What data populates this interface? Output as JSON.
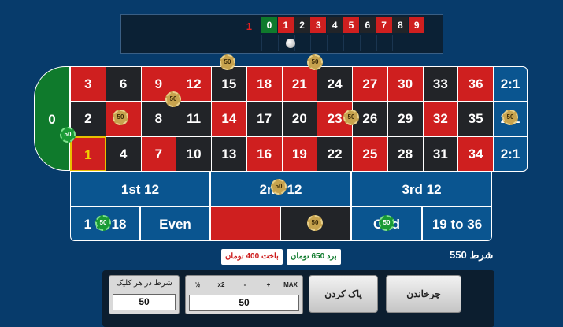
{
  "history": {
    "latest": "1",
    "numbers": [
      {
        "n": "0",
        "color": "green"
      },
      {
        "n": "1",
        "color": "red"
      },
      {
        "n": "2",
        "color": "black"
      },
      {
        "n": "3",
        "color": "red"
      },
      {
        "n": "4",
        "color": "black"
      },
      {
        "n": "5",
        "color": "red"
      },
      {
        "n": "6",
        "color": "black"
      },
      {
        "n": "7",
        "color": "red"
      },
      {
        "n": "8",
        "color": "black"
      },
      {
        "n": "9",
        "color": "red"
      }
    ]
  },
  "table": {
    "zero": "0",
    "rows": [
      [
        {
          "n": "3",
          "c": "red"
        },
        {
          "n": "6",
          "c": "black"
        },
        {
          "n": "9",
          "c": "red"
        },
        {
          "n": "12",
          "c": "red"
        },
        {
          "n": "15",
          "c": "black"
        },
        {
          "n": "18",
          "c": "red"
        },
        {
          "n": "21",
          "c": "red"
        },
        {
          "n": "24",
          "c": "black"
        },
        {
          "n": "27",
          "c": "red"
        },
        {
          "n": "30",
          "c": "red"
        },
        {
          "n": "33",
          "c": "black"
        },
        {
          "n": "36",
          "c": "red"
        }
      ],
      [
        {
          "n": "2",
          "c": "black"
        },
        {
          "n": "5",
          "c": "red"
        },
        {
          "n": "8",
          "c": "black"
        },
        {
          "n": "11",
          "c": "black"
        },
        {
          "n": "14",
          "c": "red"
        },
        {
          "n": "17",
          "c": "black"
        },
        {
          "n": "20",
          "c": "black"
        },
        {
          "n": "23",
          "c": "red"
        },
        {
          "n": "26",
          "c": "black"
        },
        {
          "n": "29",
          "c": "black"
        },
        {
          "n": "32",
          "c": "red"
        },
        {
          "n": "35",
          "c": "black"
        }
      ],
      [
        {
          "n": "1",
          "c": "red"
        },
        {
          "n": "4",
          "c": "black"
        },
        {
          "n": "7",
          "c": "red"
        },
        {
          "n": "10",
          "c": "black"
        },
        {
          "n": "13",
          "c": "black"
        },
        {
          "n": "16",
          "c": "red"
        },
        {
          "n": "19",
          "c": "red"
        },
        {
          "n": "22",
          "c": "black"
        },
        {
          "n": "25",
          "c": "red"
        },
        {
          "n": "28",
          "c": "black"
        },
        {
          "n": "31",
          "c": "black"
        },
        {
          "n": "34",
          "c": "red"
        }
      ]
    ],
    "columns": [
      "2:1",
      "2:1",
      "2:1"
    ],
    "dozens": [
      "1st 12",
      "2nd 12",
      "3rd 12"
    ],
    "outside": {
      "low": "1 to 18",
      "even": "Even",
      "odd": "Odd",
      "high": "19 to 36"
    },
    "chips": [
      "50",
      "50",
      "50",
      "50",
      "50",
      "50",
      "50",
      "50",
      "50",
      "50",
      "50"
    ],
    "highlight": "1"
  },
  "result": {
    "loss": "باخت 400 تومان",
    "win": "برد 650 تومان",
    "total_bet": "شرط 550"
  },
  "controls": {
    "per_click_label": "شرط در هر کلیک",
    "per_click_value": "50",
    "bet_value": "50",
    "half": "½",
    "double": "x2",
    "minus": "-",
    "plus": "+",
    "max": "MAX",
    "clear": "پاک کردن",
    "spin": "چرخاندن"
  },
  "colors": {
    "red": "#cf1f1f",
    "black": "#222428",
    "green": "#0f7a2c",
    "felt": "#0a5590",
    "background": "#073b6b"
  }
}
